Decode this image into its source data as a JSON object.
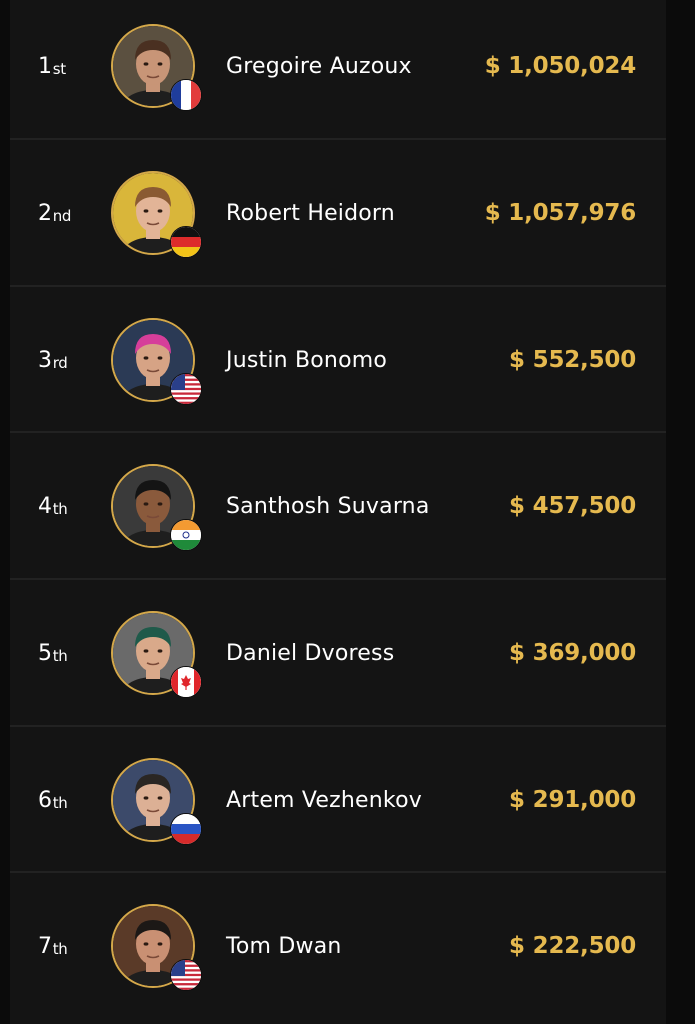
{
  "results": [
    {
      "place_num": "1",
      "place_suffix": "st",
      "name": "Gregoire Auzoux",
      "prize": "$ 1,050,024",
      "flag": "france-flag-icon",
      "avatar": "player-photo"
    },
    {
      "place_num": "2",
      "place_suffix": "nd",
      "name": "Robert Heidorn",
      "prize": "$ 1,057,976",
      "flag": "germany-flag-icon",
      "avatar": "player-photo"
    },
    {
      "place_num": "3",
      "place_suffix": "rd",
      "name": "Justin Bonomo",
      "prize": "$ 552,500",
      "flag": "usa-flag-icon",
      "avatar": "player-photo"
    },
    {
      "place_num": "4",
      "place_suffix": "th",
      "name": "Santhosh Suvarna",
      "prize": "$ 457,500",
      "flag": "india-flag-icon",
      "avatar": "player-photo"
    },
    {
      "place_num": "5",
      "place_suffix": "th",
      "name": "Daniel Dvoress",
      "prize": "$ 369,000",
      "flag": "canada-flag-icon",
      "avatar": "player-photo"
    },
    {
      "place_num": "6",
      "place_suffix": "th",
      "name": "Artem Vezhenkov",
      "prize": "$ 291,000",
      "flag": "russia-flag-icon",
      "avatar": "player-photo"
    },
    {
      "place_num": "7",
      "place_suffix": "th",
      "name": "Tom Dwan",
      "prize": "$ 222,500",
      "flag": "usa-flag-icon",
      "avatar": "player-photo"
    }
  ],
  "colors": {
    "background": "#0b0b0b",
    "row": "#141414",
    "prize": "#e5b94f",
    "avatar_ring": "#d4a84a",
    "text": "#ffffff"
  }
}
